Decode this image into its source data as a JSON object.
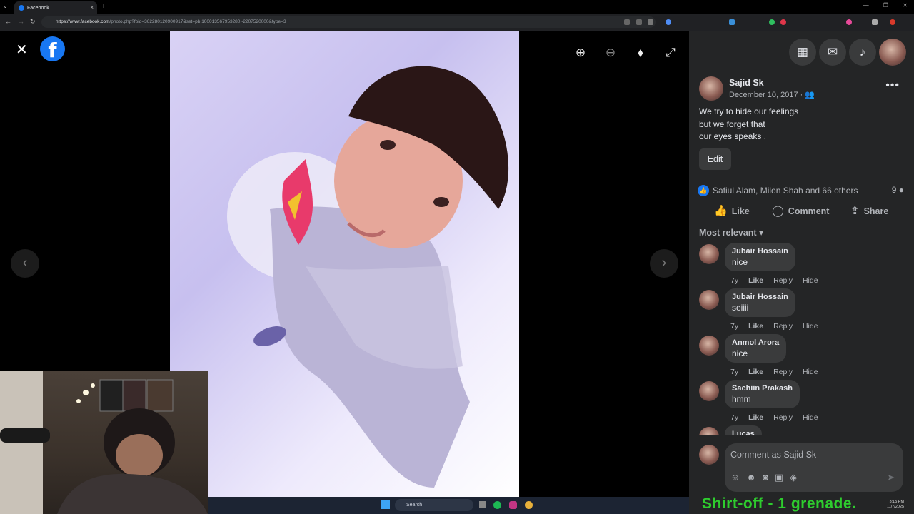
{
  "browser": {
    "tab_title": "Facebook",
    "url_domain": "https://www.facebook.com",
    "url_rest": "/photo.php?fbid=362280120900917&set=pb.100013567953280.-2207520000&type=3",
    "new_tab_glyph": "+",
    "tab_close_glyph": "×"
  },
  "viewer": {
    "close_glyph": "✕",
    "logo_letter": "f",
    "prev_glyph": "‹",
    "next_glyph": "›"
  },
  "post": {
    "author": "Sajid Sk",
    "date": "December 10, 2017 ·",
    "caption": [
      "We try to hide our feelings",
      "but we forget that",
      "our eyes speaks ."
    ],
    "edit_label": "Edit",
    "reactions_text": "Safiul Alam, Milon Shah and 66 others",
    "comment_count": "9",
    "actions": {
      "like": "Like",
      "comment": "Comment",
      "share": "Share"
    },
    "sort_label": "Most relevant ▾"
  },
  "comments": [
    {
      "name": "Jubair Hossain",
      "text": "nice",
      "age": "7y",
      "like": "Like",
      "reply": "Reply",
      "hide": "Hide"
    },
    {
      "name": "Jubair Hossain",
      "text": "seiiii",
      "age": "7y",
      "like": "Like",
      "reply": "Reply",
      "hide": "Hide"
    },
    {
      "name": "Anmol Arora",
      "text": "nice",
      "age": "7y",
      "like": "Like",
      "reply": "Reply",
      "hide": "Hide"
    },
    {
      "name": "Sachiin Prakash",
      "text": "hmm",
      "age": "7y",
      "like": "Like",
      "reply": "Reply",
      "hide": "Hide"
    },
    {
      "name": "Lucas",
      "text": "",
      "age": "",
      "like": "",
      "reply": "",
      "hide": ""
    }
  ],
  "composer": {
    "placeholder": "Comment as Sajid Sk"
  },
  "taskbar": {
    "search_label": "Search",
    "time": "3:15 PM",
    "date": "11/7/2025"
  },
  "overlay": {
    "text": "Shirt-off -   1 grenade."
  },
  "colors": {
    "fb_blue": "#1877f2",
    "panel_bg": "#242526",
    "overlay_green": "#2ecc2e"
  }
}
